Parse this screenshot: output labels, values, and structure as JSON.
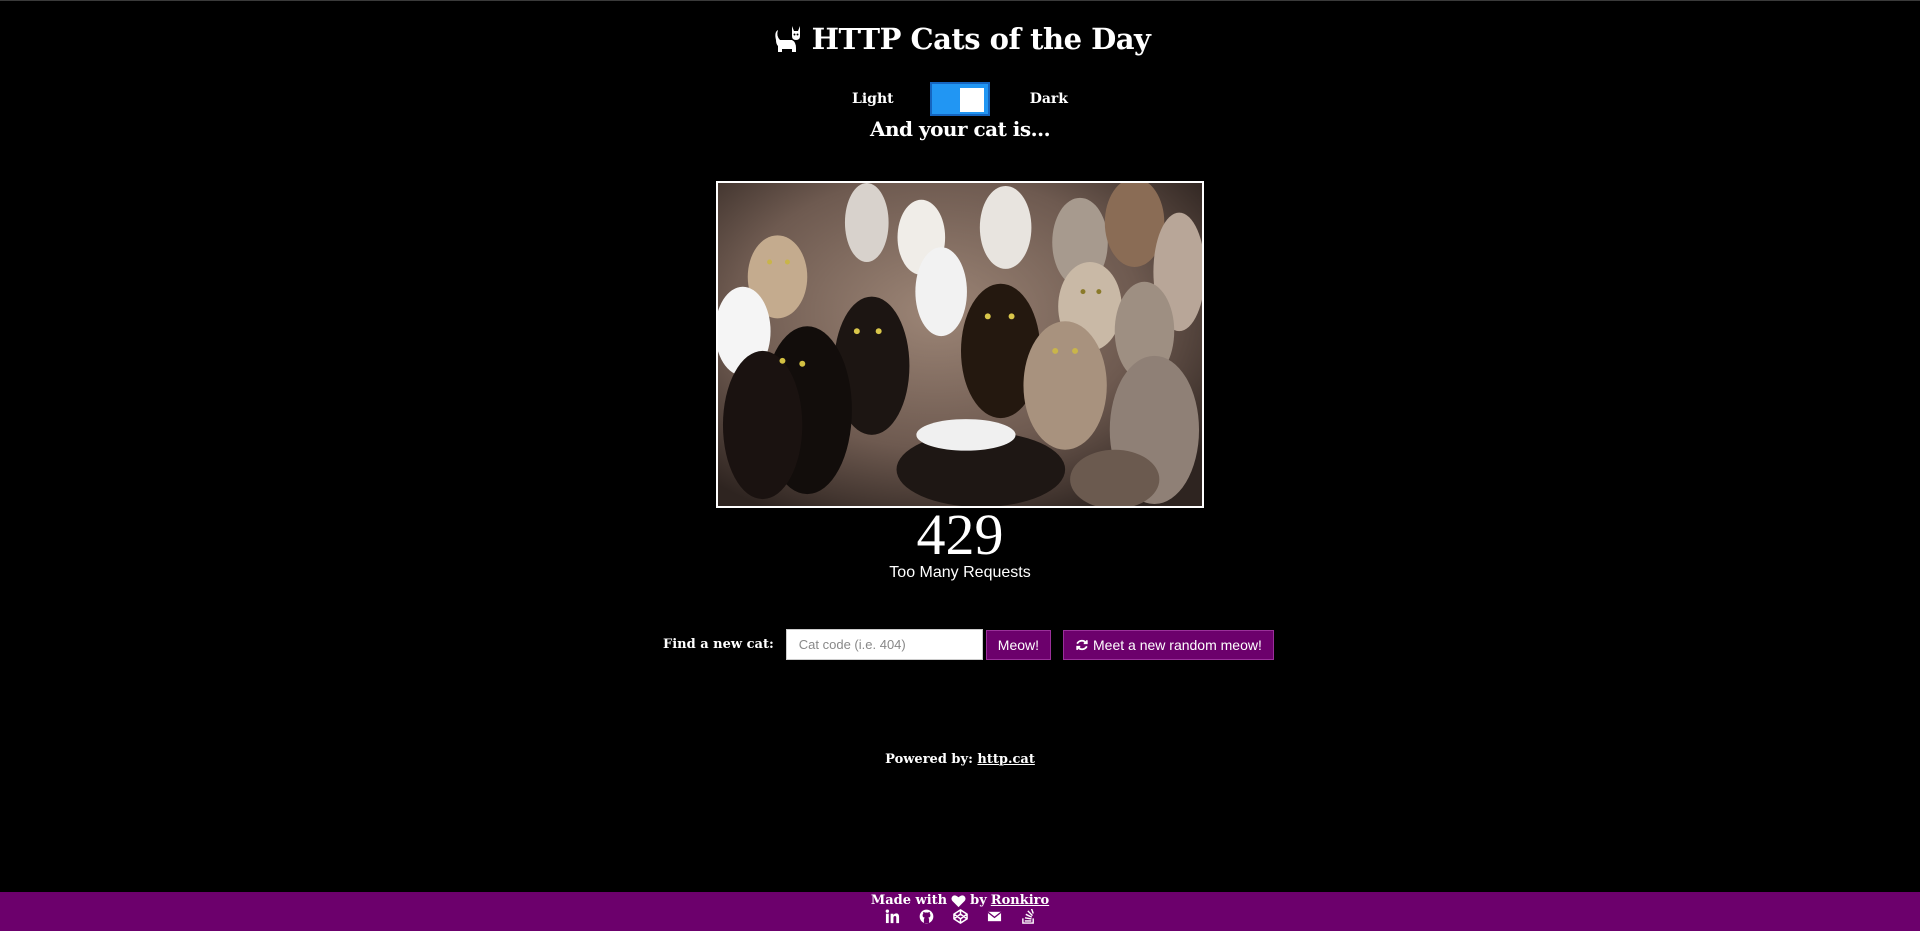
{
  "header": {
    "title": "HTTP Cats of the Day",
    "icon": "cat-icon"
  },
  "theme_toggle": {
    "light_label": "Light",
    "dark_label": "Dark",
    "state": "dark",
    "accent_color": "#2196f3"
  },
  "main": {
    "subtitle": "And your cat is...",
    "cat_image_description_icon": "cat-photo",
    "status_code": "429",
    "status_text": "Too Many Requests"
  },
  "search": {
    "label": "Find a new cat:",
    "placeholder": "Cat code (i.e. 404)",
    "value": "",
    "submit_label": "Meow!",
    "random_label": "Meet a new random meow!",
    "random_icon": "refresh-icon"
  },
  "powered": {
    "prefix": "Powered by:",
    "link_text": "http.cat"
  },
  "footer": {
    "made_with": "Made with",
    "by": "by",
    "author": "Ronkiro",
    "heart_icon": "heart-icon",
    "social_icons": [
      "linkedin-icon",
      "github-icon",
      "codepen-icon",
      "envelope-icon",
      "stack-overflow-icon"
    ],
    "background_color": "#6c006c"
  },
  "colors": {
    "background": "#000000",
    "button": "#6c006c",
    "text": "#ffffff"
  }
}
